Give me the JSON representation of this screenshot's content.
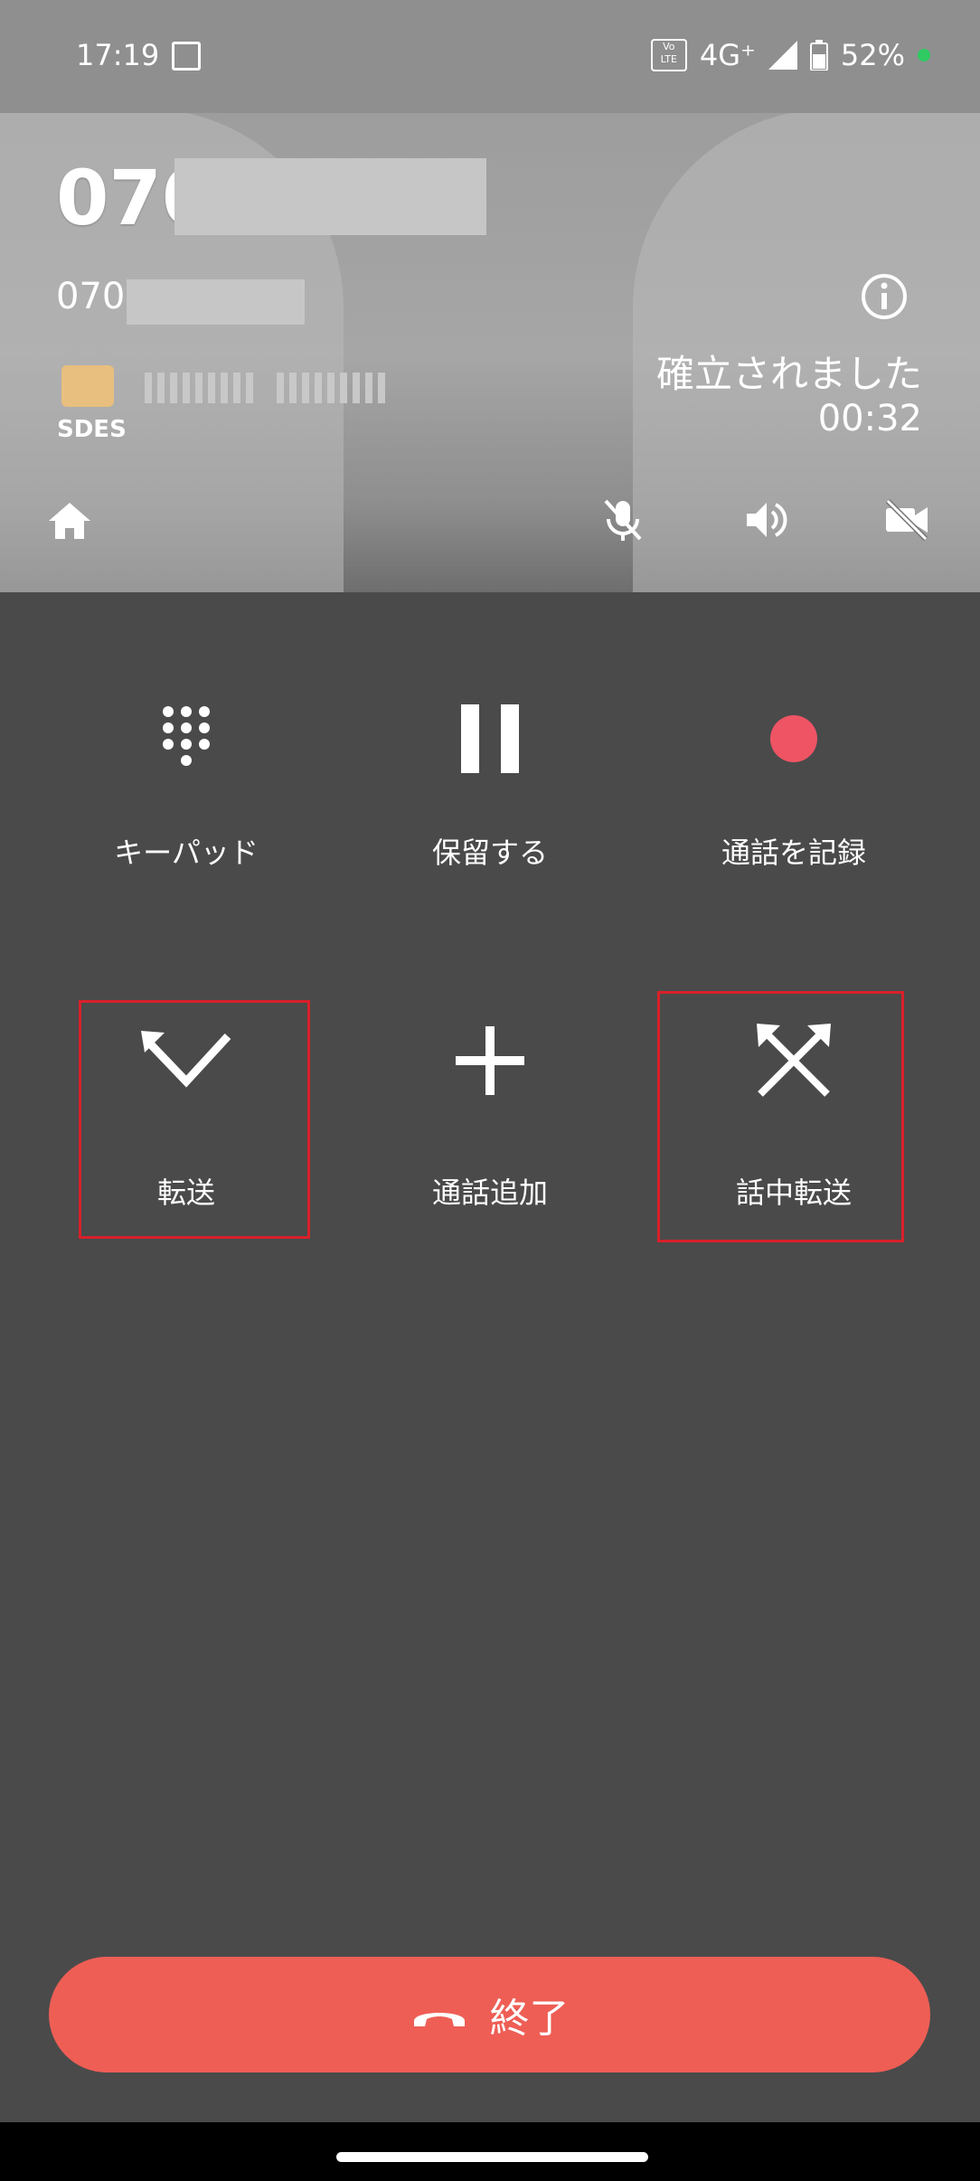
{
  "status_bar": {
    "time": "17:19",
    "network": "4G⁺",
    "battery": "52%"
  },
  "call": {
    "number_title": "070",
    "number_sub": "070",
    "security": "SDES",
    "status": "確立されました",
    "duration": "00:32"
  },
  "header_actions": {
    "home": "home-icon",
    "mute": "mic-off-icon",
    "speaker": "volume-icon",
    "video": "video-off-icon"
  },
  "buttons": {
    "keypad": "キーパッド",
    "hold": "保留する",
    "record": "通話を記録",
    "transfer": "転送",
    "add_call": "通話追加",
    "attended_transfer": "話中転送"
  },
  "end_call": "終了",
  "colors": {
    "end": "#ee5e55",
    "record": "#ee5464",
    "highlight": "#d8202a",
    "lock": "#e8bf7f"
  }
}
